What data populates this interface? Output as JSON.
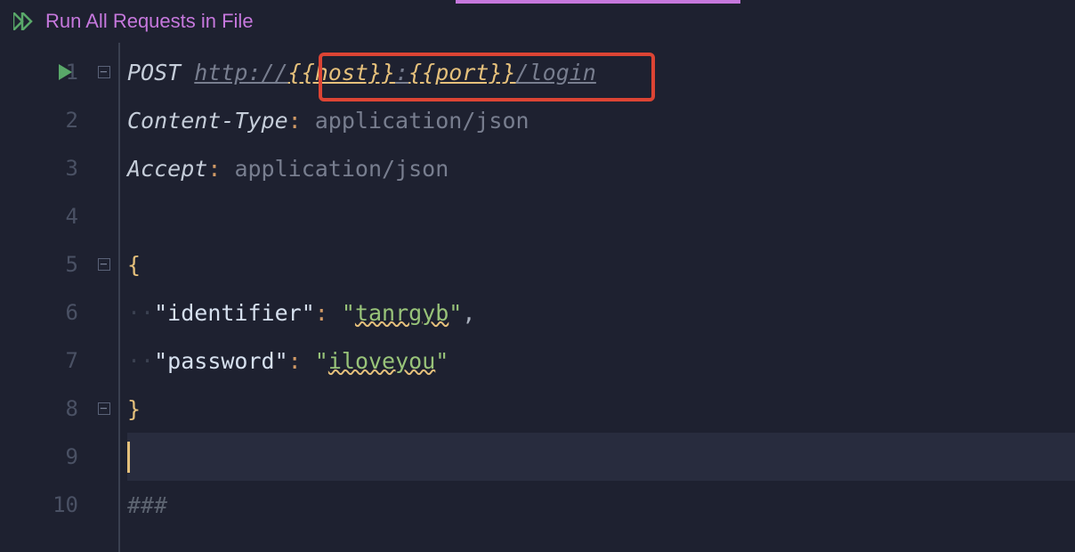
{
  "toolbar": {
    "run_all_label": "Run All Requests in File"
  },
  "lines": {
    "1": {
      "num": "1",
      "method": "POST",
      "url_prefix": "http://",
      "var1": "{{host}}",
      "sep": ":",
      "var2": "{{port}}",
      "path": "/login"
    },
    "2": {
      "num": "2",
      "header_name": "Content-Type",
      "header_val": "application/json"
    },
    "3": {
      "num": "3",
      "header_name": "Accept",
      "header_val": "application/json"
    },
    "4": {
      "num": "4"
    },
    "5": {
      "num": "5",
      "brace": "{"
    },
    "6": {
      "num": "6",
      "key": "identifier",
      "val": "tanrgyb",
      "comma": ","
    },
    "7": {
      "num": "7",
      "key": "password",
      "val": "iloveyou"
    },
    "8": {
      "num": "8",
      "brace": "}"
    },
    "9": {
      "num": "9"
    },
    "10": {
      "num": "10",
      "sep": "###"
    }
  }
}
